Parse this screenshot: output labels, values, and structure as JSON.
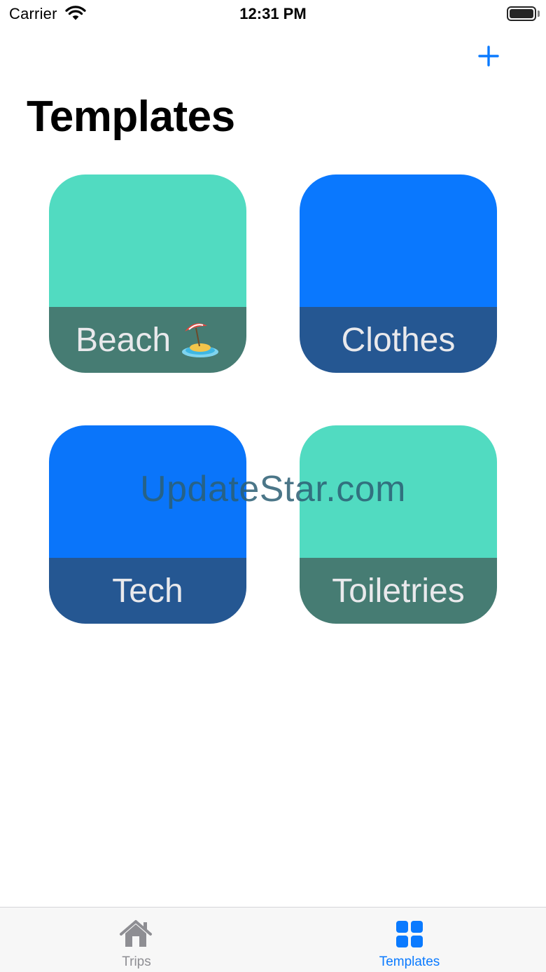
{
  "status_bar": {
    "carrier": "Carrier",
    "time": "12:31 PM",
    "wifi_icon": "wifi-icon",
    "battery_icon": "battery-icon"
  },
  "nav": {
    "add_icon": "plus-icon",
    "title": "Templates"
  },
  "templates": [
    {
      "label": "Beach",
      "emoji_icon": "beach-umbrella-icon",
      "top_color": "#51dbc1",
      "bottom_color": "#467c73"
    },
    {
      "label": "Clothes",
      "emoji_icon": "",
      "top_color": "#0a78fe",
      "bottom_color": "#255792"
    },
    {
      "label": "Tech",
      "emoji_icon": "",
      "top_color": "#0a75fa",
      "bottom_color": "#255792"
    },
    {
      "label": "Toiletries",
      "emoji_icon": "",
      "top_color": "#51dbc1",
      "bottom_color": "#467c73"
    }
  ],
  "watermark": "UpdateStar.com",
  "tab_bar": {
    "tabs": [
      {
        "label": "Trips",
        "icon": "house-icon",
        "selected": false
      },
      {
        "label": "Templates",
        "icon": "grid-icon",
        "selected": true
      }
    ],
    "active_color": "#0a7aff",
    "inactive_color": "#8e8e93"
  }
}
